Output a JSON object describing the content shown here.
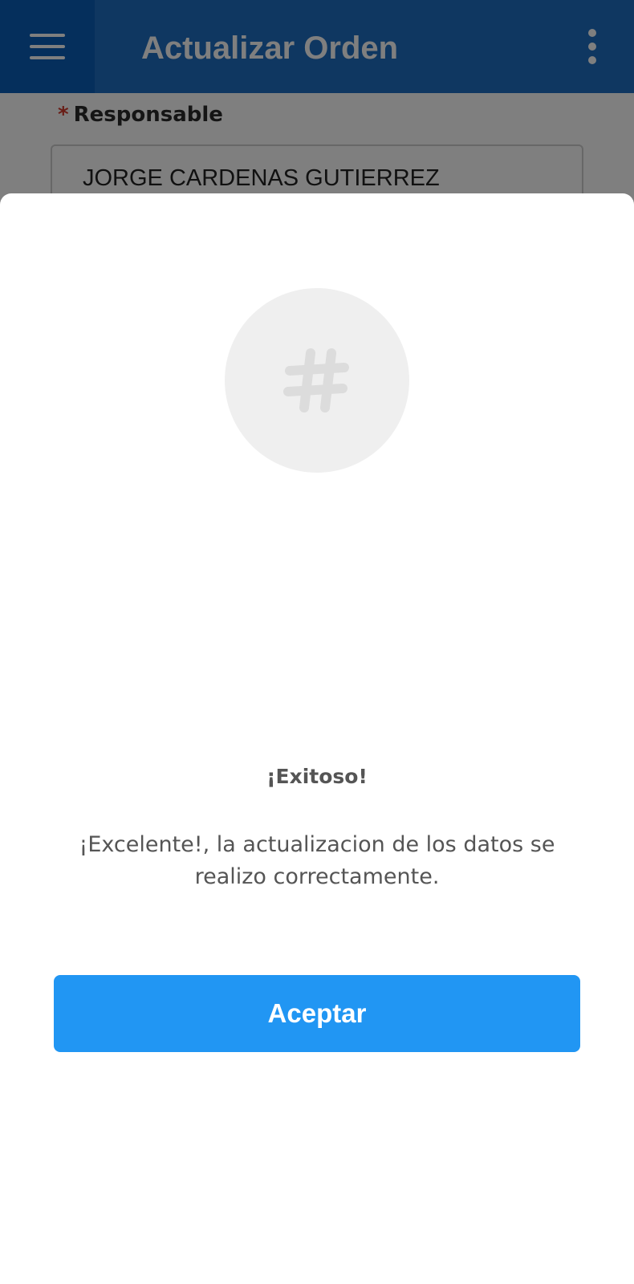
{
  "appbar": {
    "title": "Actualizar Orden",
    "menu_icon": "hamburger-menu-icon",
    "overflow_icon": "more-vertical-icon",
    "color": "#1f6fc2"
  },
  "form": {
    "responsable": {
      "required_mark": "*",
      "label": "Responsable",
      "value": "JORGE CARDENAS GUTIERREZ"
    }
  },
  "dialog": {
    "icon": "hashtag-icon",
    "title": "¡Exitoso!",
    "message": "¡Excelente!, la actualizacion de los datos se realizo correctamente.",
    "accept_label": "Aceptar",
    "accept_color": "#2196f3"
  }
}
